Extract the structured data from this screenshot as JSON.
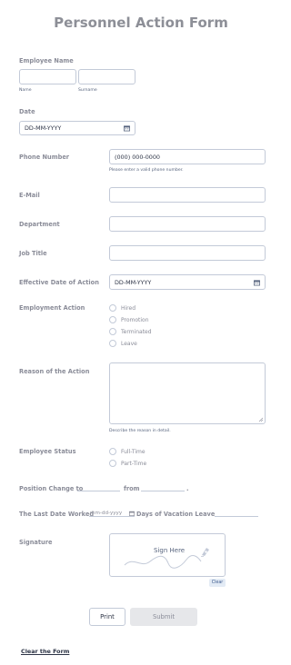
{
  "title": "Personnel Action Form",
  "employee_name": {
    "label": "Employee Name",
    "first_sublabel": "Name",
    "last_sublabel": "Surname",
    "first_value": "",
    "last_value": ""
  },
  "date": {
    "label": "Date",
    "placeholder": "DD-MM-YYYY"
  },
  "phone": {
    "label": "Phone Number",
    "placeholder": "(000) 000-0000",
    "hint": "Please enter a valid phone number."
  },
  "email": {
    "label": "E-Mail"
  },
  "department": {
    "label": "Department"
  },
  "job_title": {
    "label": "Job Title"
  },
  "effective_date": {
    "label": "Effective Date of Action",
    "placeholder": "DD-MM-YYYY"
  },
  "employment_action": {
    "label": "Employment Action",
    "options": [
      "Hired",
      "Promotion",
      "Terminated",
      "Leave"
    ]
  },
  "reason": {
    "label": "Reason of the Action",
    "hint": "Describe the reason in detail."
  },
  "employee_status": {
    "label": "Employee Status",
    "options": [
      "Full-Time",
      "Part-Time"
    ]
  },
  "position_change": {
    "label": "Position Change to",
    "from_label": "from",
    "end_punct": "."
  },
  "last_date": {
    "label": "The Last Date Worked",
    "placeholder": "mm-dd-yyyy",
    "vacation_label": "Days of Vacation Leave"
  },
  "signature": {
    "label": "Signature",
    "placeholder": "Sign Here",
    "clear_label": "Clear"
  },
  "buttons": {
    "print": "Print",
    "submit": "Submit"
  },
  "footer": {
    "clear_form": "Clear the Form"
  },
  "colors": {
    "label": "#8a8c98",
    "border": "#c3cad8",
    "text": "#2c3345",
    "submit_bg": "#e6e7ea"
  }
}
